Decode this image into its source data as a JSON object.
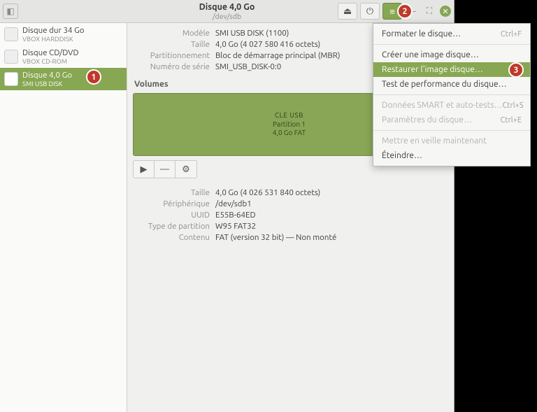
{
  "title": {
    "line1": "Disque 4,0 Go",
    "line2": "/dev/sdb"
  },
  "header_icons": {
    "eject": "⏏",
    "power": "⏻",
    "hamburger": "≡",
    "minimize": "–",
    "restore": "⛶",
    "close": "✕"
  },
  "sidebar": [
    {
      "l1": "Disque dur 34 Go",
      "l2": "VBOX HARDDISK",
      "selected": false
    },
    {
      "l1": "Disque CD/DVD",
      "l2": "VBOX CD-ROM",
      "selected": false
    },
    {
      "l1": "Disque 4,0 Go",
      "l2": "SMI USB DISK",
      "selected": true
    }
  ],
  "drive_props": [
    {
      "k": "Modèle",
      "v": "SMI USB DISK (1100)"
    },
    {
      "k": "Taille",
      "v": "4,0 Go (4 027 580 416 octets)"
    },
    {
      "k": "Partitionnement",
      "v": "Bloc de démarrage principal (MBR)"
    },
    {
      "k": "Numéro de série",
      "v": "SMI_USB_DISK-0:0"
    }
  ],
  "volumes_title": "Volumes",
  "volmap": {
    "a": "CLE USB",
    "b": "Partition 1",
    "c": "4,0 Go FAT"
  },
  "voltool": {
    "play": "▶",
    "minus": "—",
    "gear": "⚙"
  },
  "part_props": [
    {
      "k": "Taille",
      "v": "4,0 Go (4 026 531 840 octets)"
    },
    {
      "k": "Périphérique",
      "v": "/dev/sdb1"
    },
    {
      "k": "UUID",
      "v": "E55B-64ED"
    },
    {
      "k": "Type de partition",
      "v": "W95 FAT32"
    },
    {
      "k": "Contenu",
      "v": "FAT (version 32 bit) — Non monté"
    }
  ],
  "menu": [
    {
      "label": "Formater le disque…",
      "acc": "Ctrl+F",
      "type": "item"
    },
    {
      "type": "sep"
    },
    {
      "label": "Créer une image disque…",
      "type": "item"
    },
    {
      "label": "Restaurer l'image disque…",
      "type": "item",
      "selected": true
    },
    {
      "label": "Test de performance du disque…",
      "type": "item"
    },
    {
      "type": "sep"
    },
    {
      "label": "Données SMART et auto-tests…",
      "acc": "Ctrl+S",
      "type": "item",
      "disabled": true
    },
    {
      "label": "Paramètres du disque…",
      "acc": "Ctrl+E",
      "type": "item",
      "disabled": true
    },
    {
      "type": "sep"
    },
    {
      "label": "Mettre en veille maintenant",
      "type": "item",
      "disabled": true
    },
    {
      "label": "Éteindre…",
      "type": "item"
    }
  ],
  "badges": {
    "b1": "1",
    "b2": "2",
    "b3": "3"
  }
}
